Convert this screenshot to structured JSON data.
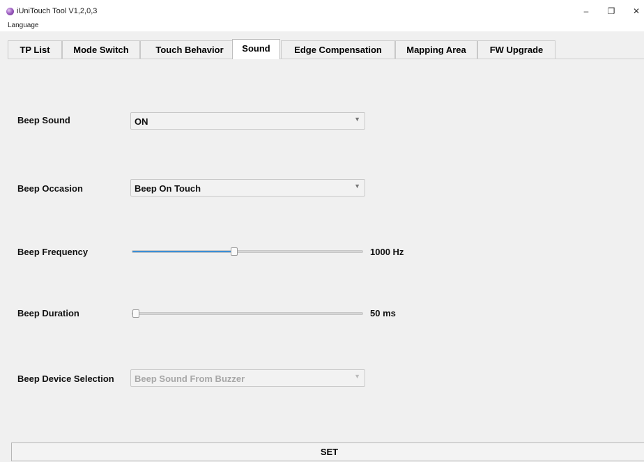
{
  "window": {
    "title": "iUniTouch Tool V1,2,0,3",
    "controls": {
      "minimize": "–",
      "restore": "❐",
      "close": "✕"
    }
  },
  "menu": {
    "items": [
      "Language"
    ]
  },
  "tabs": [
    {
      "label": "TP List"
    },
    {
      "label": "Mode Switch"
    },
    {
      "label": "Touch Behavior"
    },
    {
      "label": "Sound",
      "active": true
    },
    {
      "label": "Edge Compensation"
    },
    {
      "label": "Mapping Area"
    },
    {
      "label": "FW Upgrade"
    }
  ],
  "sound": {
    "beep_sound": {
      "label": "Beep Sound",
      "value": "ON"
    },
    "beep_occasion": {
      "label": "Beep Occasion",
      "value": "Beep On Touch"
    },
    "beep_frequency": {
      "label": "Beep Frequency",
      "value_label": "1000 Hz",
      "level": 0.44
    },
    "beep_duration": {
      "label": "Beep Duration",
      "value_label": "50 ms",
      "level": 0.0
    },
    "beep_device": {
      "label": "Beep Device Selection",
      "value": "Beep Sound From Buzzer",
      "disabled": true
    }
  },
  "actions": {
    "set_label": "SET"
  },
  "icons": {
    "app": "app-icon",
    "dropdown": "chevron-down-icon"
  },
  "colors": {
    "accent": "#3d8fd6",
    "background": "#f0f0f0"
  }
}
